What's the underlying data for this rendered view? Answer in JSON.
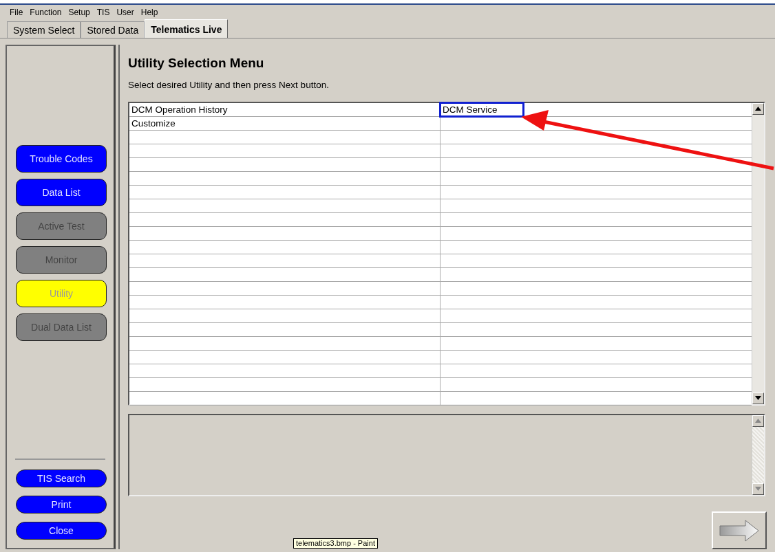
{
  "menu": [
    "File",
    "Function",
    "Setup",
    "TIS",
    "User",
    "Help"
  ],
  "tabs": [
    {
      "label": "System Select",
      "selected": false
    },
    {
      "label": "Stored Data",
      "selected": false
    },
    {
      "label": "Telematics Live",
      "selected": true
    }
  ],
  "sidebar": {
    "functions": [
      {
        "label": "Trouble Codes",
        "disabled": false,
        "selected": false
      },
      {
        "label": "Data List",
        "disabled": false,
        "selected": false
      },
      {
        "label": "Active Test",
        "disabled": true,
        "selected": false
      },
      {
        "label": "Monitor",
        "disabled": true,
        "selected": false
      },
      {
        "label": "Utility",
        "disabled": false,
        "selected": true
      },
      {
        "label": "Dual Data List",
        "disabled": true,
        "selected": false
      }
    ],
    "tools": [
      {
        "label": "TIS Search"
      },
      {
        "label": "Print"
      },
      {
        "label": "Close"
      }
    ]
  },
  "main": {
    "title": "Utility Selection Menu",
    "instruction": "Select desired Utility and then press Next button.",
    "rows": [
      [
        {
          "text": "DCM Operation History",
          "highlighted": false
        },
        {
          "text": "DCM Service",
          "highlighted": true
        }
      ],
      [
        {
          "text": "Customize",
          "highlighted": false
        }
      ]
    ],
    "callout_arrow": true
  },
  "tooltip": "telematics3.bmp - Paint"
}
